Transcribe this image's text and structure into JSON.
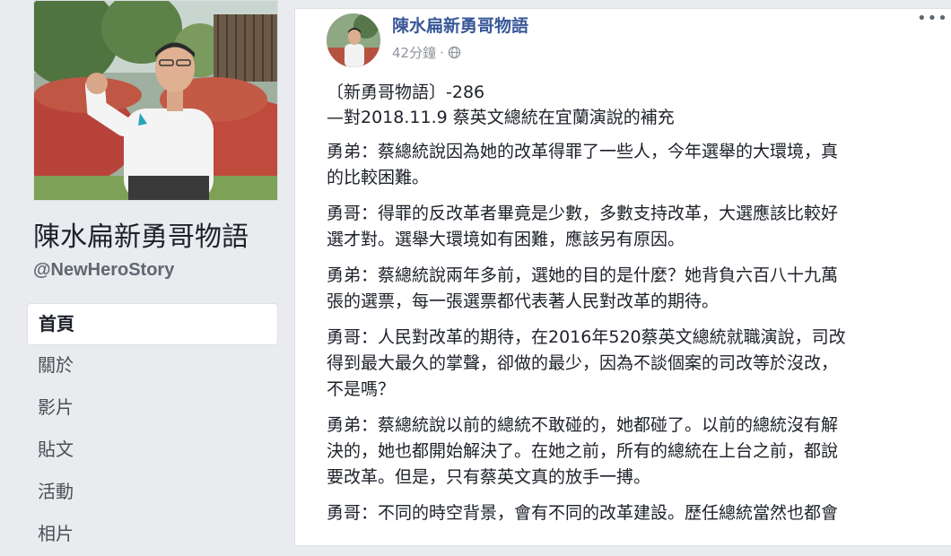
{
  "page": {
    "name": "陳水扁新勇哥物語",
    "handle": "@NewHeroStory"
  },
  "nav": {
    "items": [
      {
        "label": "首頁"
      },
      {
        "label": "關於"
      },
      {
        "label": "影片"
      },
      {
        "label": "貼文"
      },
      {
        "label": "活動"
      },
      {
        "label": "相片"
      }
    ]
  },
  "post": {
    "author": "陳水扁新勇哥物語",
    "time": "42分鐘",
    "dot": "·",
    "more": "•••",
    "title_line1": "〔新勇哥物語〕-286",
    "title_line2": "—對2018.11.9 蔡英文總統在宜蘭演說的補充",
    "paragraphs": [
      "勇弟：蔡總統說因為她的改革得罪了一些人，今年選舉的大環境，真\n的比較困難。",
      "勇哥：得罪的反改革者畢竟是少數，多數支持改革，大選應該比較好\n選才對。選舉大環境如有困難，應該另有原因。",
      "勇弟：蔡總統說兩年多前，選她的目的是什麼？她背負六百八十九萬\n張的選票，每一張選票都代表著人民對改革的期待。",
      "勇哥：人民對改革的期待，在2016年520蔡英文總統就職演說，司改\n得到最大最久的掌聲，卻做的最少，因為不談個案的司改等於沒改，\n不是嗎？",
      "勇弟：蔡總統說以前的總統不敢碰的，她都碰了。以前的總統沒有解\n決的，她也都開始解決了。在她之前，所有的總統在上台之前，都說\n要改革。但是，只有蔡英文真的放手一搏。",
      "勇哥：不同的時空背景，會有不同的改革建設。歷任總統當然也都會"
    ]
  }
}
